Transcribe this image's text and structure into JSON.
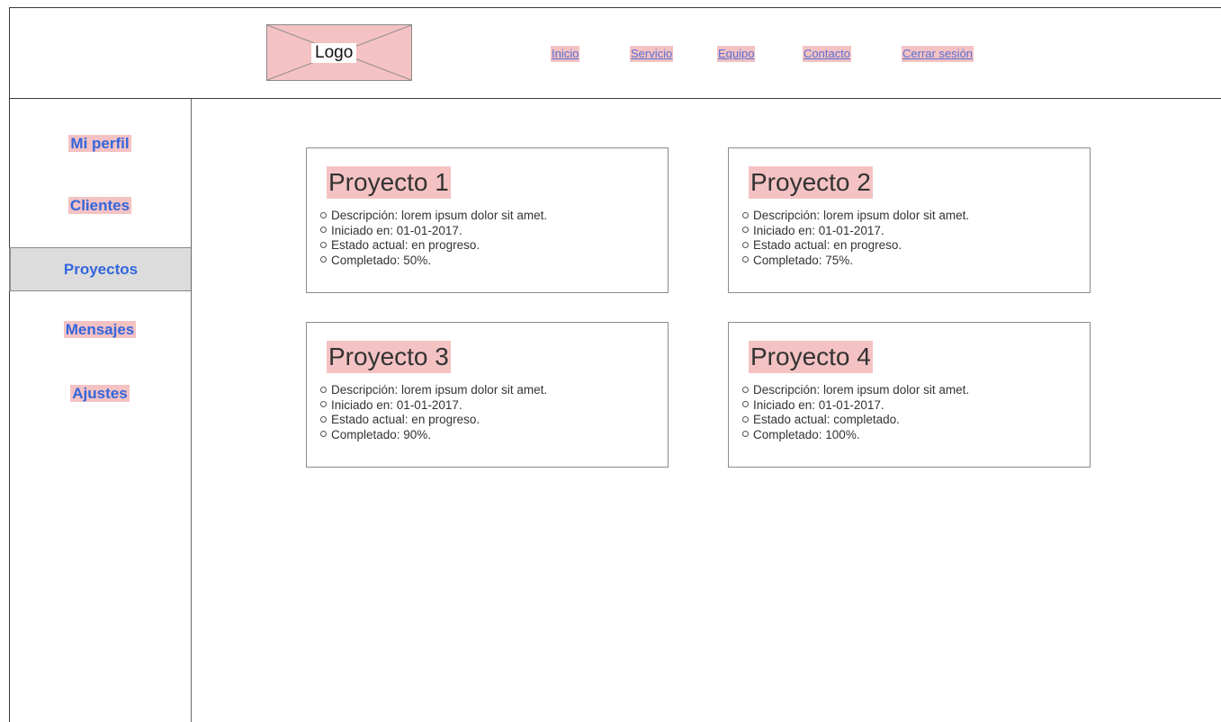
{
  "header": {
    "logo_label": "Logo",
    "nav": [
      "Inicio",
      "Servicio",
      "Equipo",
      "Contacto",
      "Cerrar sesión"
    ]
  },
  "sidebar": {
    "items": [
      "Mi perfil",
      "Clientes",
      "Proyectos",
      "Mensajes",
      "Ajustes"
    ],
    "active": "Proyectos"
  },
  "projects": [
    {
      "title": "Proyecto 1",
      "details": [
        "Descripción: lorem ipsum dolor sit amet.",
        "Iniciado en: 01-01-2017.",
        "Estado actual: en progreso.",
        "Completado: 50%."
      ]
    },
    {
      "title": "Proyecto 2",
      "details": [
        "Descripción: lorem ipsum dolor sit amet.",
        "Iniciado en: 01-01-2017.",
        "Estado actual: en progreso.",
        "Completado: 75%."
      ]
    },
    {
      "title": "Proyecto 3",
      "details": [
        "Descripción: lorem ipsum dolor sit amet.",
        "Iniciado en: 01-01-2017.",
        "Estado actual: en progreso.",
        "Completado: 90%."
      ]
    },
    {
      "title": "Proyecto 4",
      "details": [
        "Descripción: lorem ipsum dolor sit amet.",
        "Iniciado en: 01-01-2017.",
        "Estado actual: completado.",
        "Completado: 100%."
      ]
    }
  ],
  "colors": {
    "highlight": "#f4c2c2",
    "link": "#5a6fd4",
    "sidebar_link": "#3366dd",
    "active_bg": "#dcdcdc"
  }
}
